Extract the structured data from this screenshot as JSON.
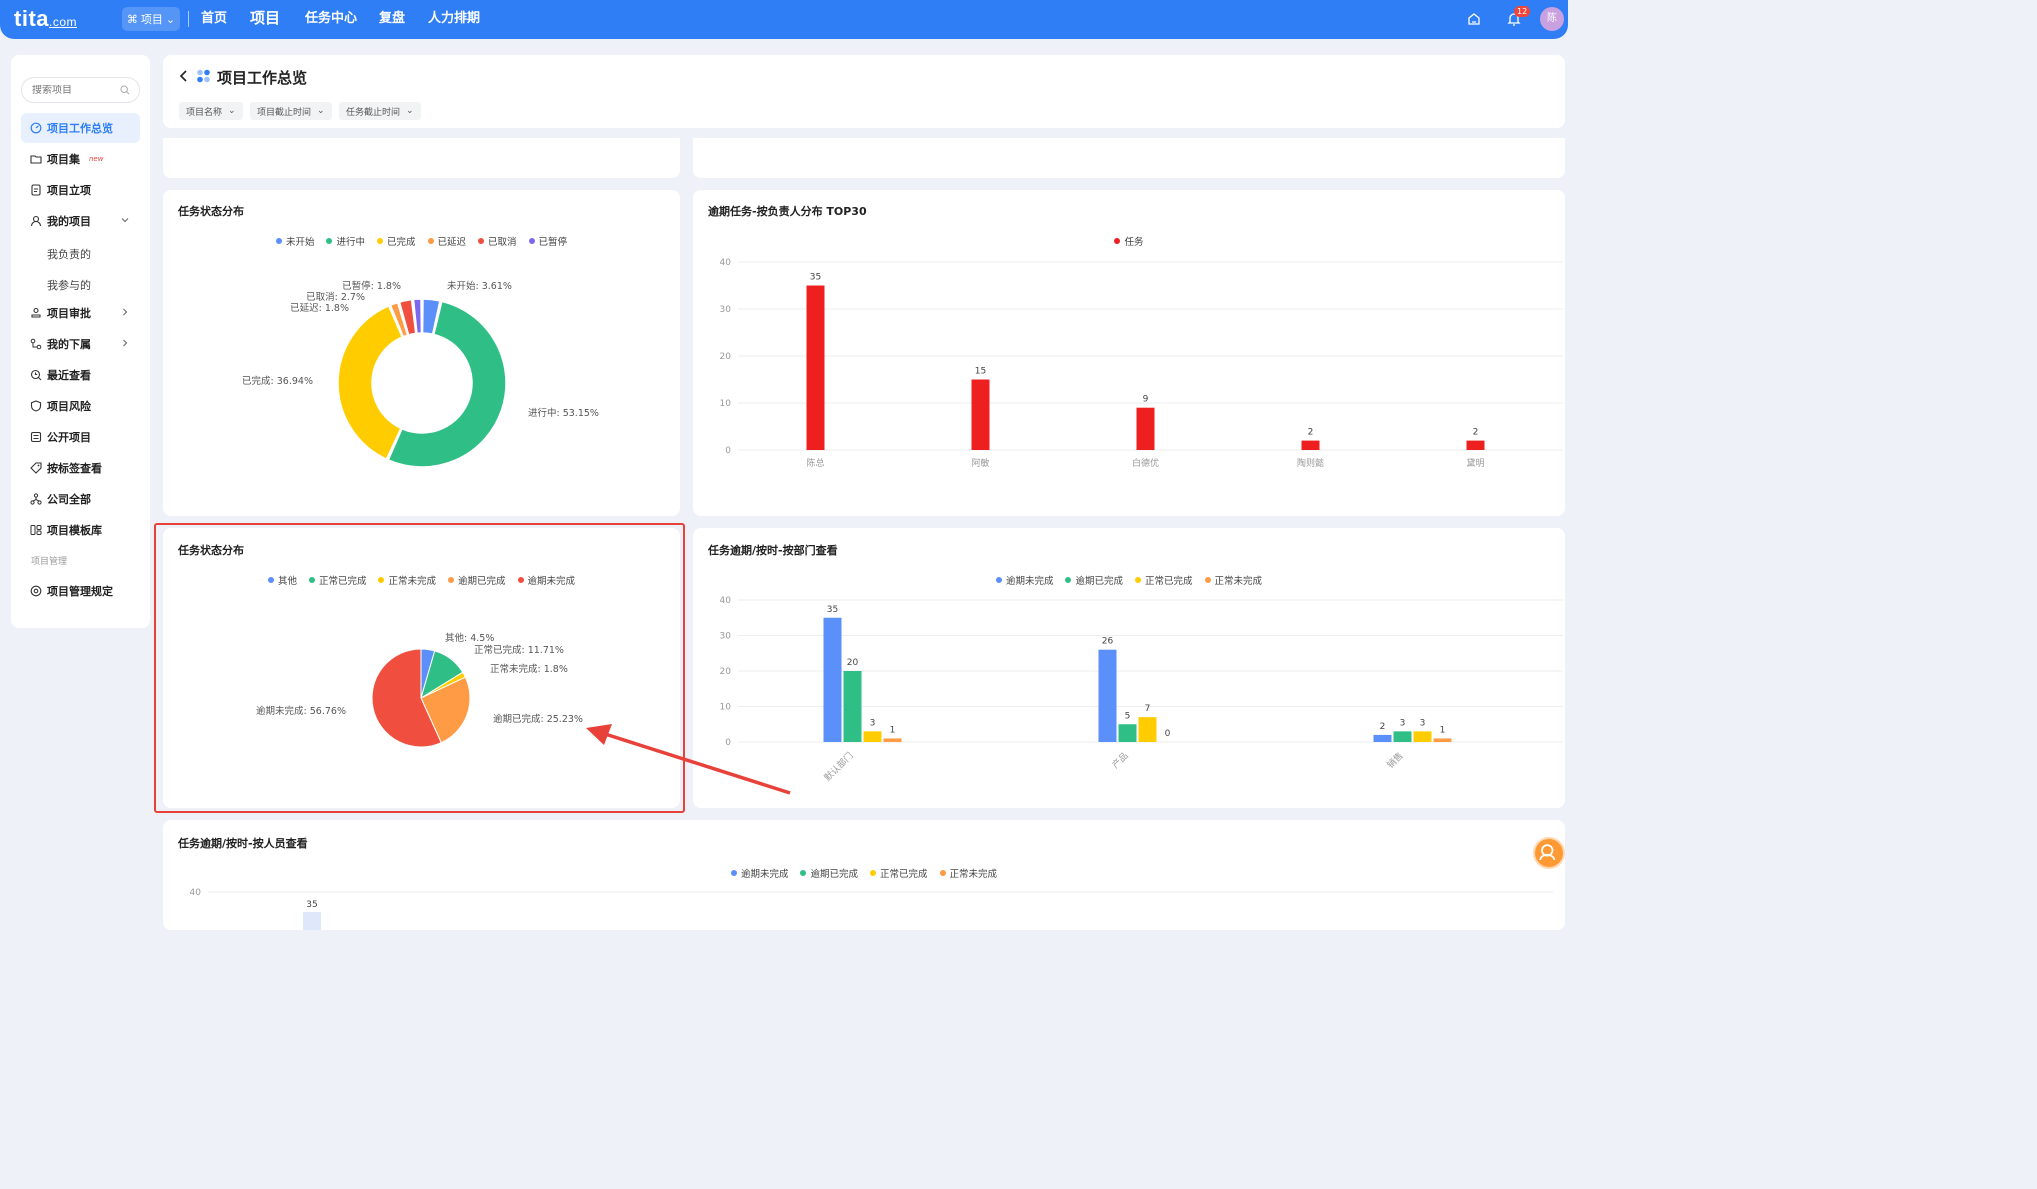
{
  "app": {
    "logo": "tita",
    "logo_suffix": ".com",
    "module_switch": "项目"
  },
  "nav": {
    "items": [
      "首页",
      "项目",
      "任务中心",
      "复盘",
      "人力排期"
    ],
    "notification_count": "12",
    "avatar_text": "陈"
  },
  "sidebar": {
    "search_placeholder": "搜索项目",
    "items": [
      {
        "label": "项目工作总览",
        "icon": "gauge-icon",
        "active": true
      },
      {
        "label": "项目集",
        "icon": "folder-icon",
        "tag": "new"
      },
      {
        "label": "项目立项",
        "icon": "doc-icon"
      },
      {
        "label": "我的项目",
        "icon": "user-icon",
        "expanded": true
      },
      {
        "label": "项目审批",
        "icon": "approval-icon"
      },
      {
        "label": "我的下属",
        "icon": "org-icon"
      },
      {
        "label": "最近查看",
        "icon": "recent-icon"
      },
      {
        "label": "项目风险",
        "icon": "shield-icon"
      },
      {
        "label": "公开项目",
        "icon": "list-icon"
      },
      {
        "label": "按标签查看",
        "icon": "tag-icon"
      },
      {
        "label": "公司全部",
        "icon": "company-icon"
      },
      {
        "label": "项目模板库",
        "icon": "template-icon"
      },
      {
        "label": "项目管理规定",
        "icon": "settings-icon"
      }
    ],
    "sub_items": [
      "我负责的",
      "我参与的"
    ],
    "section_label": "项目管理"
  },
  "header": {
    "title": "项目工作总览",
    "filters": [
      "项目名称",
      "项目截止时间",
      "任务截止时间"
    ]
  },
  "colors": {
    "blue": "#5b8ff9",
    "green": "#2fbf86",
    "yellow": "#ffcc00",
    "orange": "#ff9a45",
    "red": "#f04f3f",
    "purple": "#7b68ee",
    "bar_red": "#ee1f1f",
    "accent": "#2f7ef5"
  },
  "chart_data": [
    {
      "type": "pie",
      "title": "任务状态分布",
      "donut": true,
      "legend": [
        "未开始",
        "进行中",
        "已完成",
        "已延迟",
        "已取消",
        "已暂停"
      ],
      "slices": [
        {
          "name": "未开始",
          "value": 3.61,
          "label": "未开始: 3.61%"
        },
        {
          "name": "进行中",
          "value": 53.15,
          "label": "进行中: 53.15%"
        },
        {
          "name": "已完成",
          "value": 36.94,
          "label": "已完成: 36.94%"
        },
        {
          "name": "已延迟",
          "value": 1.8,
          "label": "已延迟: 1.8%"
        },
        {
          "name": "已取消",
          "value": 2.7,
          "label": "已取消: 2.7%"
        },
        {
          "name": "已暂停",
          "value": 1.8,
          "label": "已暂停: 1.8%"
        }
      ]
    },
    {
      "type": "bar",
      "title": "逾期任务-按负责人分布 TOP30",
      "legend": [
        "任务"
      ],
      "categories": [
        "陈总",
        "阿敏",
        "白德优",
        "陶则懿",
        "黛明"
      ],
      "values": [
        35,
        15,
        9,
        2,
        2
      ],
      "ylim": [
        0,
        40
      ],
      "yticks": [
        0,
        10,
        20,
        30,
        40
      ]
    },
    {
      "type": "pie",
      "title": "任务状态分布",
      "legend": [
        "其他",
        "正常已完成",
        "正常未完成",
        "逾期已完成",
        "逾期未完成"
      ],
      "slices": [
        {
          "name": "其他",
          "value": 4.5,
          "label": "其他: 4.5%"
        },
        {
          "name": "正常已完成",
          "value": 11.71,
          "label": "正常已完成: 11.71%"
        },
        {
          "name": "正常未完成",
          "value": 1.8,
          "label": "正常未完成: 1.8%"
        },
        {
          "name": "逾期已完成",
          "value": 25.23,
          "label": "逾期已完成: 25.23%"
        },
        {
          "name": "逾期未完成",
          "value": 56.76,
          "label": "逾期未完成: 56.76%"
        }
      ]
    },
    {
      "type": "bar",
      "title": "任务逾期/按时-按部门查看",
      "categories": [
        "默认部门",
        "产品",
        "销售"
      ],
      "series": [
        {
          "name": "逾期未完成",
          "values": [
            35,
            26,
            2
          ]
        },
        {
          "name": "逾期已完成",
          "values": [
            20,
            5,
            3
          ]
        },
        {
          "name": "正常已完成",
          "values": [
            3,
            7,
            3
          ]
        },
        {
          "name": "正常未完成",
          "values": [
            1,
            0,
            1
          ]
        }
      ],
      "ylim": [
        0,
        40
      ],
      "yticks": [
        0,
        10,
        20,
        30,
        40
      ]
    },
    {
      "type": "bar",
      "title": "任务逾期/按时-按人员查看",
      "legend": [
        "逾期未完成",
        "逾期已完成",
        "正常已完成",
        "正常未完成"
      ],
      "visible_first_value": 35,
      "ytick_top": 40
    }
  ]
}
